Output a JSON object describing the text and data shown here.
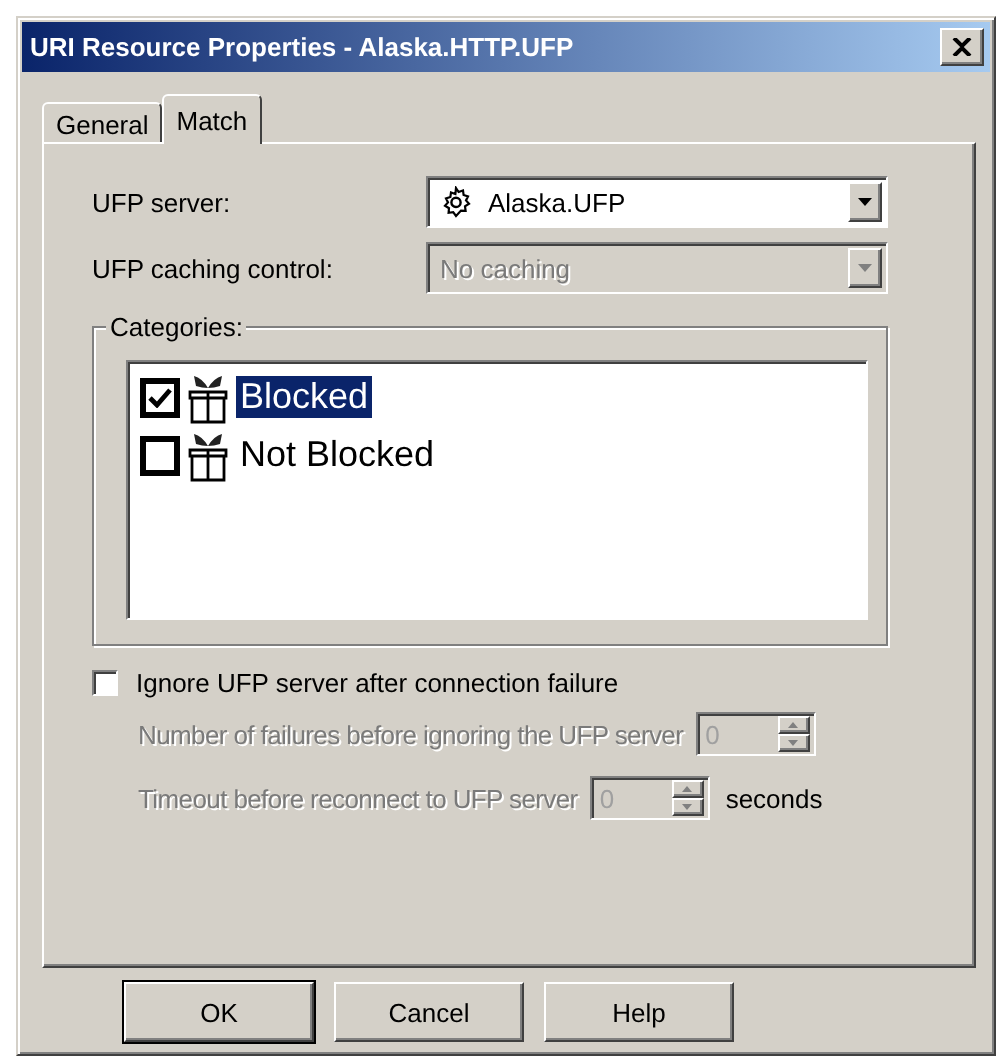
{
  "window": {
    "title": "URI Resource Properties - Alaska.HTTP.UFP"
  },
  "tabs": [
    {
      "label": "General",
      "selected": false
    },
    {
      "label": "Match",
      "selected": true
    }
  ],
  "combos": [
    {
      "label": "UFP server:",
      "value": "Alaska.UFP",
      "disabled": false,
      "kind": "gear"
    },
    {
      "label": "UFP caching control:",
      "value": "No caching",
      "disabled": true,
      "kind": "plain"
    }
  ],
  "categories": {
    "label": "Categories:",
    "items": [
      {
        "label": "Blocked",
        "checked": true,
        "selected": true
      },
      {
        "label": "Not Blocked",
        "checked": false,
        "selected": false
      }
    ]
  },
  "ignore": {
    "label": "Ignore UFP server after connection failure",
    "checked": false
  },
  "spinners": [
    {
      "label": "Number of failures before ignoring the UFP server",
      "value": "0",
      "disabled": true
    },
    {
      "label": "Timeout before reconnect to UFP server",
      "value": "0",
      "disabled": true,
      "unit": "seconds"
    }
  ],
  "buttons": [
    {
      "label": "OK",
      "default": true
    },
    {
      "label": "Cancel",
      "default": false
    },
    {
      "label": "Help",
      "default": false
    }
  ]
}
